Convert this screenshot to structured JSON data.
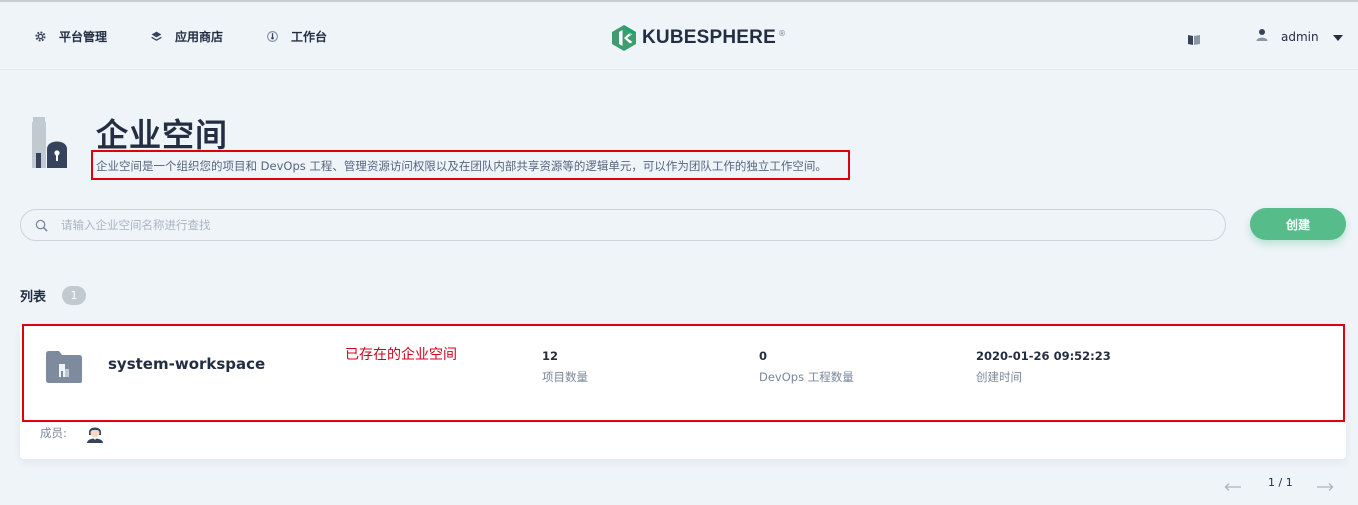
{
  "nav": {
    "items": [
      {
        "label": "平台管理",
        "icon": "gear-icon"
      },
      {
        "label": "应用商店",
        "icon": "stack-icon"
      },
      {
        "label": "工作台",
        "icon": "dashboard-icon"
      }
    ],
    "logo_text": "KUBESPHERE",
    "logo_reg": "®",
    "user": "admin"
  },
  "header": {
    "title": "企业空间",
    "description": "企业空间是一个组织您的项目和 DevOps 工程、管理资源访问权限以及在团队内部共享资源等的逻辑单元，可以作为团队工作的独立工作空间。"
  },
  "search": {
    "placeholder": "请输入企业空间名称进行查找",
    "value": ""
  },
  "create_label": "创建",
  "list": {
    "title": "列表",
    "count": "1",
    "items": [
      {
        "name": "system-workspace",
        "annotation": "已存在的企业空间",
        "stats": [
          {
            "value": "12",
            "label": "项目数量"
          },
          {
            "value": "0",
            "label": "DevOps 工程数量"
          },
          {
            "value": "2020-01-26 09:52:23",
            "label": "创建时间"
          }
        ],
        "members_label": "成员:"
      }
    ]
  },
  "pagination": {
    "text": "1 / 1"
  },
  "colors": {
    "accent": "#55bc8a",
    "annotation_red": "#e0000c",
    "background": "#eff4f9"
  }
}
